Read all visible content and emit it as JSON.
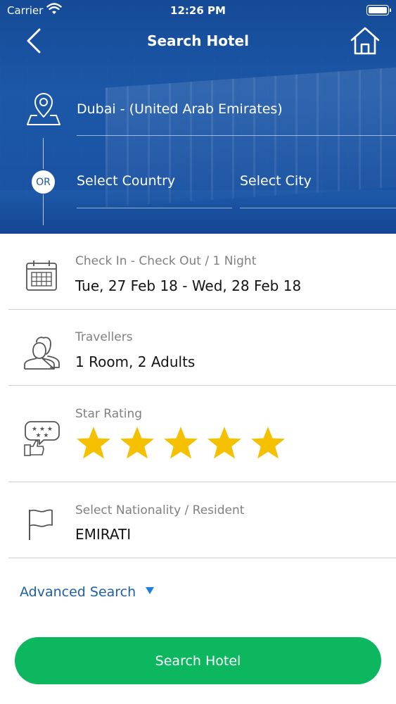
{
  "status_bar": {
    "carrier": "Carrier",
    "time": "12:26 PM"
  },
  "header": {
    "title": "Search Hotel",
    "back_icon": "chevron-left-icon",
    "home_icon": "home-icon"
  },
  "location": {
    "destination": "Dubai - (United Arab Emirates)",
    "or_label": "OR",
    "country_placeholder": "Select Country",
    "city_placeholder": "Select City"
  },
  "dates": {
    "label": "Check In - Check Out / 1 Night",
    "value": "Tue, 27 Feb 18 - Wed, 28 Feb 18"
  },
  "travellers": {
    "label": "Travellers",
    "value": "1 Room, 2 Adults"
  },
  "star_rating": {
    "label": "Star Rating",
    "selected": 5,
    "max": 5
  },
  "nationality": {
    "label": "Select Nationality / Resident",
    "value": "EMIRATI"
  },
  "advanced_search": {
    "label": "Advanced Search"
  },
  "search_button": {
    "label": "Search Hotel"
  },
  "colors": {
    "header_blue": "#1d55a3",
    "accent_blue": "#1c5fa8",
    "button_green": "#0cb760",
    "star_yellow": "#f5c000"
  }
}
